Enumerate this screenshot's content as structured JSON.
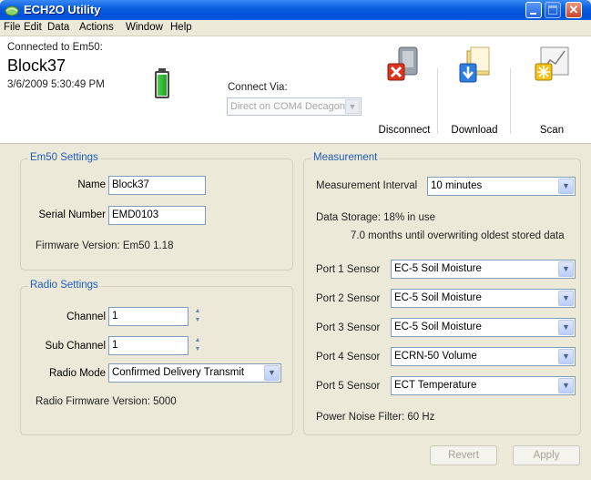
{
  "window": {
    "title": "ECH2O Utility",
    "accent_color": "#0a5fe0"
  },
  "menu": [
    "File",
    "Edit",
    "Data",
    "Actions",
    "Window",
    "Help"
  ],
  "connection": {
    "label": "Connected to Em50:",
    "device_name": "Block37",
    "timestamp": "3/6/2009 5:30:49 PM",
    "battery_level": 0.95,
    "via_label": "Connect Via:",
    "via_value": "Direct on COM4 Decagon"
  },
  "toolbar": {
    "disconnect_label": "Disconnect",
    "download_label": "Download",
    "scan_label": "Scan"
  },
  "em50_settings": {
    "title": "Em50 Settings",
    "name_label": "Name",
    "name_value": "Block37",
    "serial_label": "Serial Number",
    "serial_value": "EMD0103",
    "firmware_text": "Firmware Version: Em50 1.18"
  },
  "radio_settings": {
    "title": "Radio Settings",
    "channel_label": "Channel",
    "channel_value": "1",
    "subchannel_label": "Sub Channel",
    "subchannel_value": "1",
    "mode_label": "Radio Mode",
    "mode_value": "Confirmed Delivery Transmit",
    "firmware_text": "Radio Firmware Version: 5000"
  },
  "measurement": {
    "title": "Measurement",
    "interval_label": "Measurement Interval",
    "interval_value": "10 minutes",
    "storage_text": "Data Storage: 18% in use",
    "overwrite_text": "7.0 months until overwriting oldest stored data",
    "ports": [
      {
        "label": "Port 1 Sensor",
        "value": "EC-5 Soil Moisture"
      },
      {
        "label": "Port 2 Sensor",
        "value": "EC-5 Soil Moisture"
      },
      {
        "label": "Port 3 Sensor",
        "value": "EC-5 Soil Moisture"
      },
      {
        "label": "Port 4 Sensor",
        "value": "ECRN-50 Volume"
      },
      {
        "label": "Port 5 Sensor",
        "value": "ECT Temperature"
      }
    ],
    "noise_filter_text": "Power Noise Filter: 60 Hz"
  },
  "footer": {
    "revert_label": "Revert",
    "apply_label": "Apply"
  }
}
